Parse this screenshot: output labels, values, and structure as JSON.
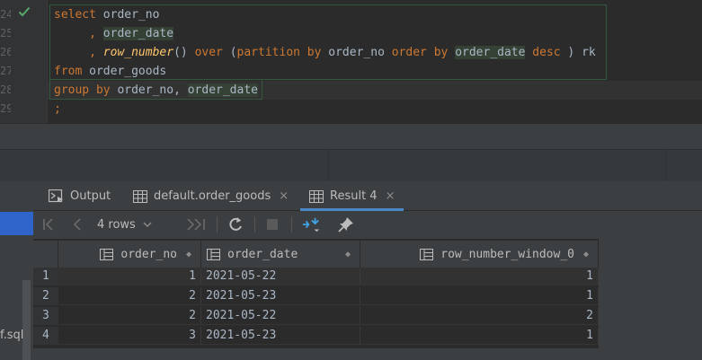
{
  "editor": {
    "line_numbers": [
      "24",
      "25",
      "26",
      "27",
      "28",
      "29"
    ],
    "lines": [
      [
        {
          "t": "select",
          "c": "kw"
        },
        {
          "t": " order_no",
          "c": "id"
        }
      ],
      [
        {
          "t": "     , ",
          "c": "kw"
        },
        {
          "t": "order_date",
          "c": "id hl"
        }
      ],
      [
        {
          "t": "     , ",
          "c": "kw"
        },
        {
          "t": "row_number",
          "c": "fn"
        },
        {
          "t": "() ",
          "c": "pl"
        },
        {
          "t": "over",
          "c": "kw"
        },
        {
          "t": " (",
          "c": "pl"
        },
        {
          "t": "partition by",
          "c": "kw"
        },
        {
          "t": " order_no ",
          "c": "id"
        },
        {
          "t": "order by",
          "c": "kw"
        },
        {
          "t": " ",
          "c": "pl"
        },
        {
          "t": "order_date",
          "c": "id hl"
        },
        {
          "t": " desc",
          "c": "kw"
        },
        {
          "t": " ) rk",
          "c": "pl"
        }
      ],
      [
        {
          "t": "from",
          "c": "kw"
        },
        {
          "t": " order_goods",
          "c": "id"
        }
      ],
      [
        {
          "t": "group by",
          "c": "kw"
        },
        {
          "t": " order_no, ",
          "c": "id"
        },
        {
          "t": "order_date",
          "c": "id hl"
        }
      ],
      [
        {
          "t": ";",
          "c": "kw"
        }
      ]
    ]
  },
  "left_panel": {
    "file_label": "f.sql"
  },
  "tabs": [
    {
      "label": "Output",
      "icon": "console-icon",
      "closable": false
    },
    {
      "label": "default.order_goods",
      "icon": "table-icon",
      "closable": true
    },
    {
      "label": "Result 4",
      "icon": "table-icon",
      "closable": true,
      "active": true
    }
  ],
  "toolbar": {
    "rows_label": "4 rows",
    "close_glyph": "×"
  },
  "grid": {
    "columns": [
      "order_no",
      "order_date",
      "row_number_window_0"
    ],
    "rows": [
      {
        "n": "1",
        "order_no": "1",
        "order_date": "2021-05-22",
        "rn": "1"
      },
      {
        "n": "2",
        "order_no": "2",
        "order_date": "2021-05-23",
        "rn": "1"
      },
      {
        "n": "3",
        "order_no": "2",
        "order_date": "2021-05-22",
        "rn": "2"
      },
      {
        "n": "4",
        "order_no": "3",
        "order_date": "2021-05-23",
        "rn": "1"
      }
    ]
  },
  "colors": {
    "keyword": "#cc7832",
    "function": "#ffc66d",
    "identifier": "#a9b7c6",
    "selection_border": "#32593d",
    "check_green": "#59a869",
    "tab_underline": "#4a88c7",
    "refresh_icon": "#bbbbbb",
    "layout_icon_blue": "#40a4e6"
  }
}
